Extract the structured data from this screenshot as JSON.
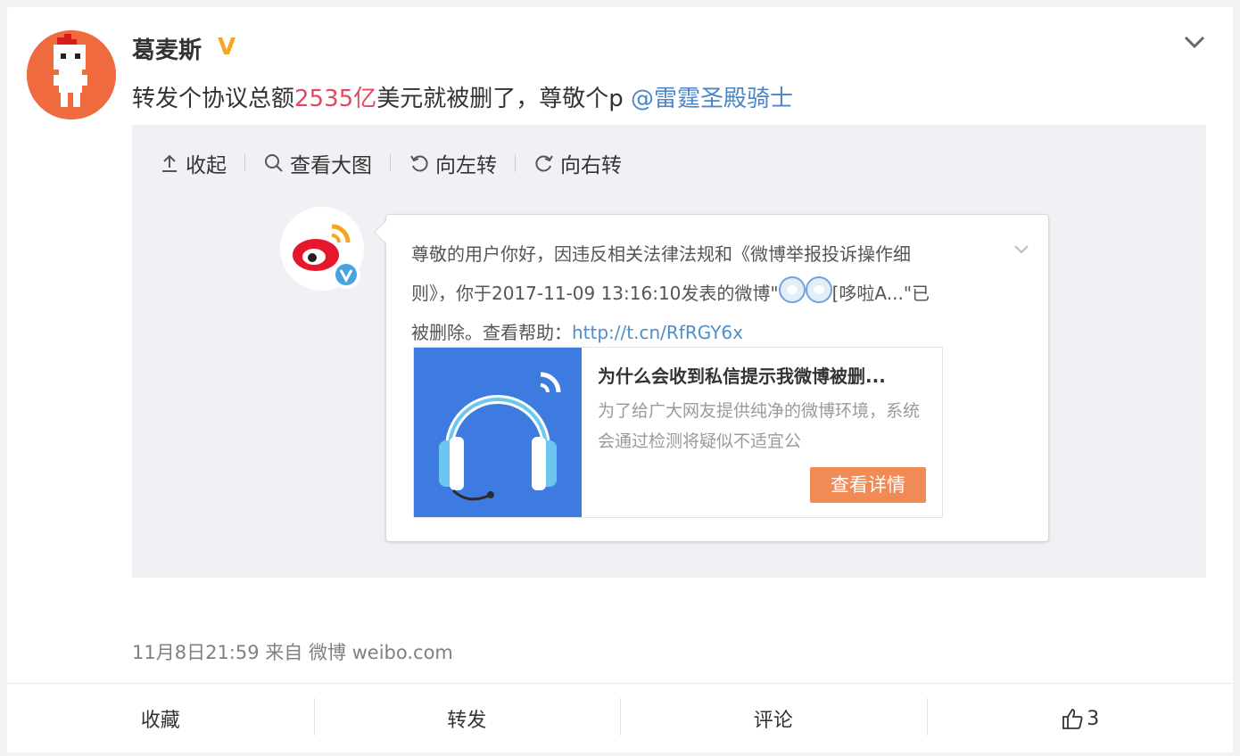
{
  "post": {
    "user_name": "葛麦斯",
    "vip_badge": "V",
    "text_before": "转发个协议总额",
    "text_amount": "2535亿",
    "text_after": "美元就被删了，尊敬个p ",
    "mention": "@雷霆圣殿骑士"
  },
  "toolbar": {
    "collapse": "收起",
    "view_large": "查看大图",
    "rotate_left": "向左转",
    "rotate_right": "向右转"
  },
  "image_content": {
    "message_line1": "尊敬的用户你好，因违反相关法律法规和《微博举报投诉操作细",
    "message_line2_a": "则》，你于2017-11-09 13:16:10发表的微博\"",
    "message_line2_b": "[哆啦A...\"已",
    "message_line3_a": "被删除。查看帮助：",
    "message_link": "http://t.cn/RfRGY6x",
    "card_title": "为什么会收到私信提示我微博被删...",
    "card_desc": "为了给广大网友提供纯净的微博环境，系统会通过检测将疑似不适宜公",
    "card_button": "查看详情"
  },
  "meta": {
    "timestamp_source": "11月8日21:59 来自 微博 weibo.com"
  },
  "actions": {
    "favorite": "收藏",
    "repost": "转发",
    "comment": "评论",
    "like_count": "3"
  },
  "colors": {
    "highlight": "#e04a5f",
    "mention": "#4a86c8",
    "badge": "#f5a623",
    "button": "#f08a57"
  }
}
